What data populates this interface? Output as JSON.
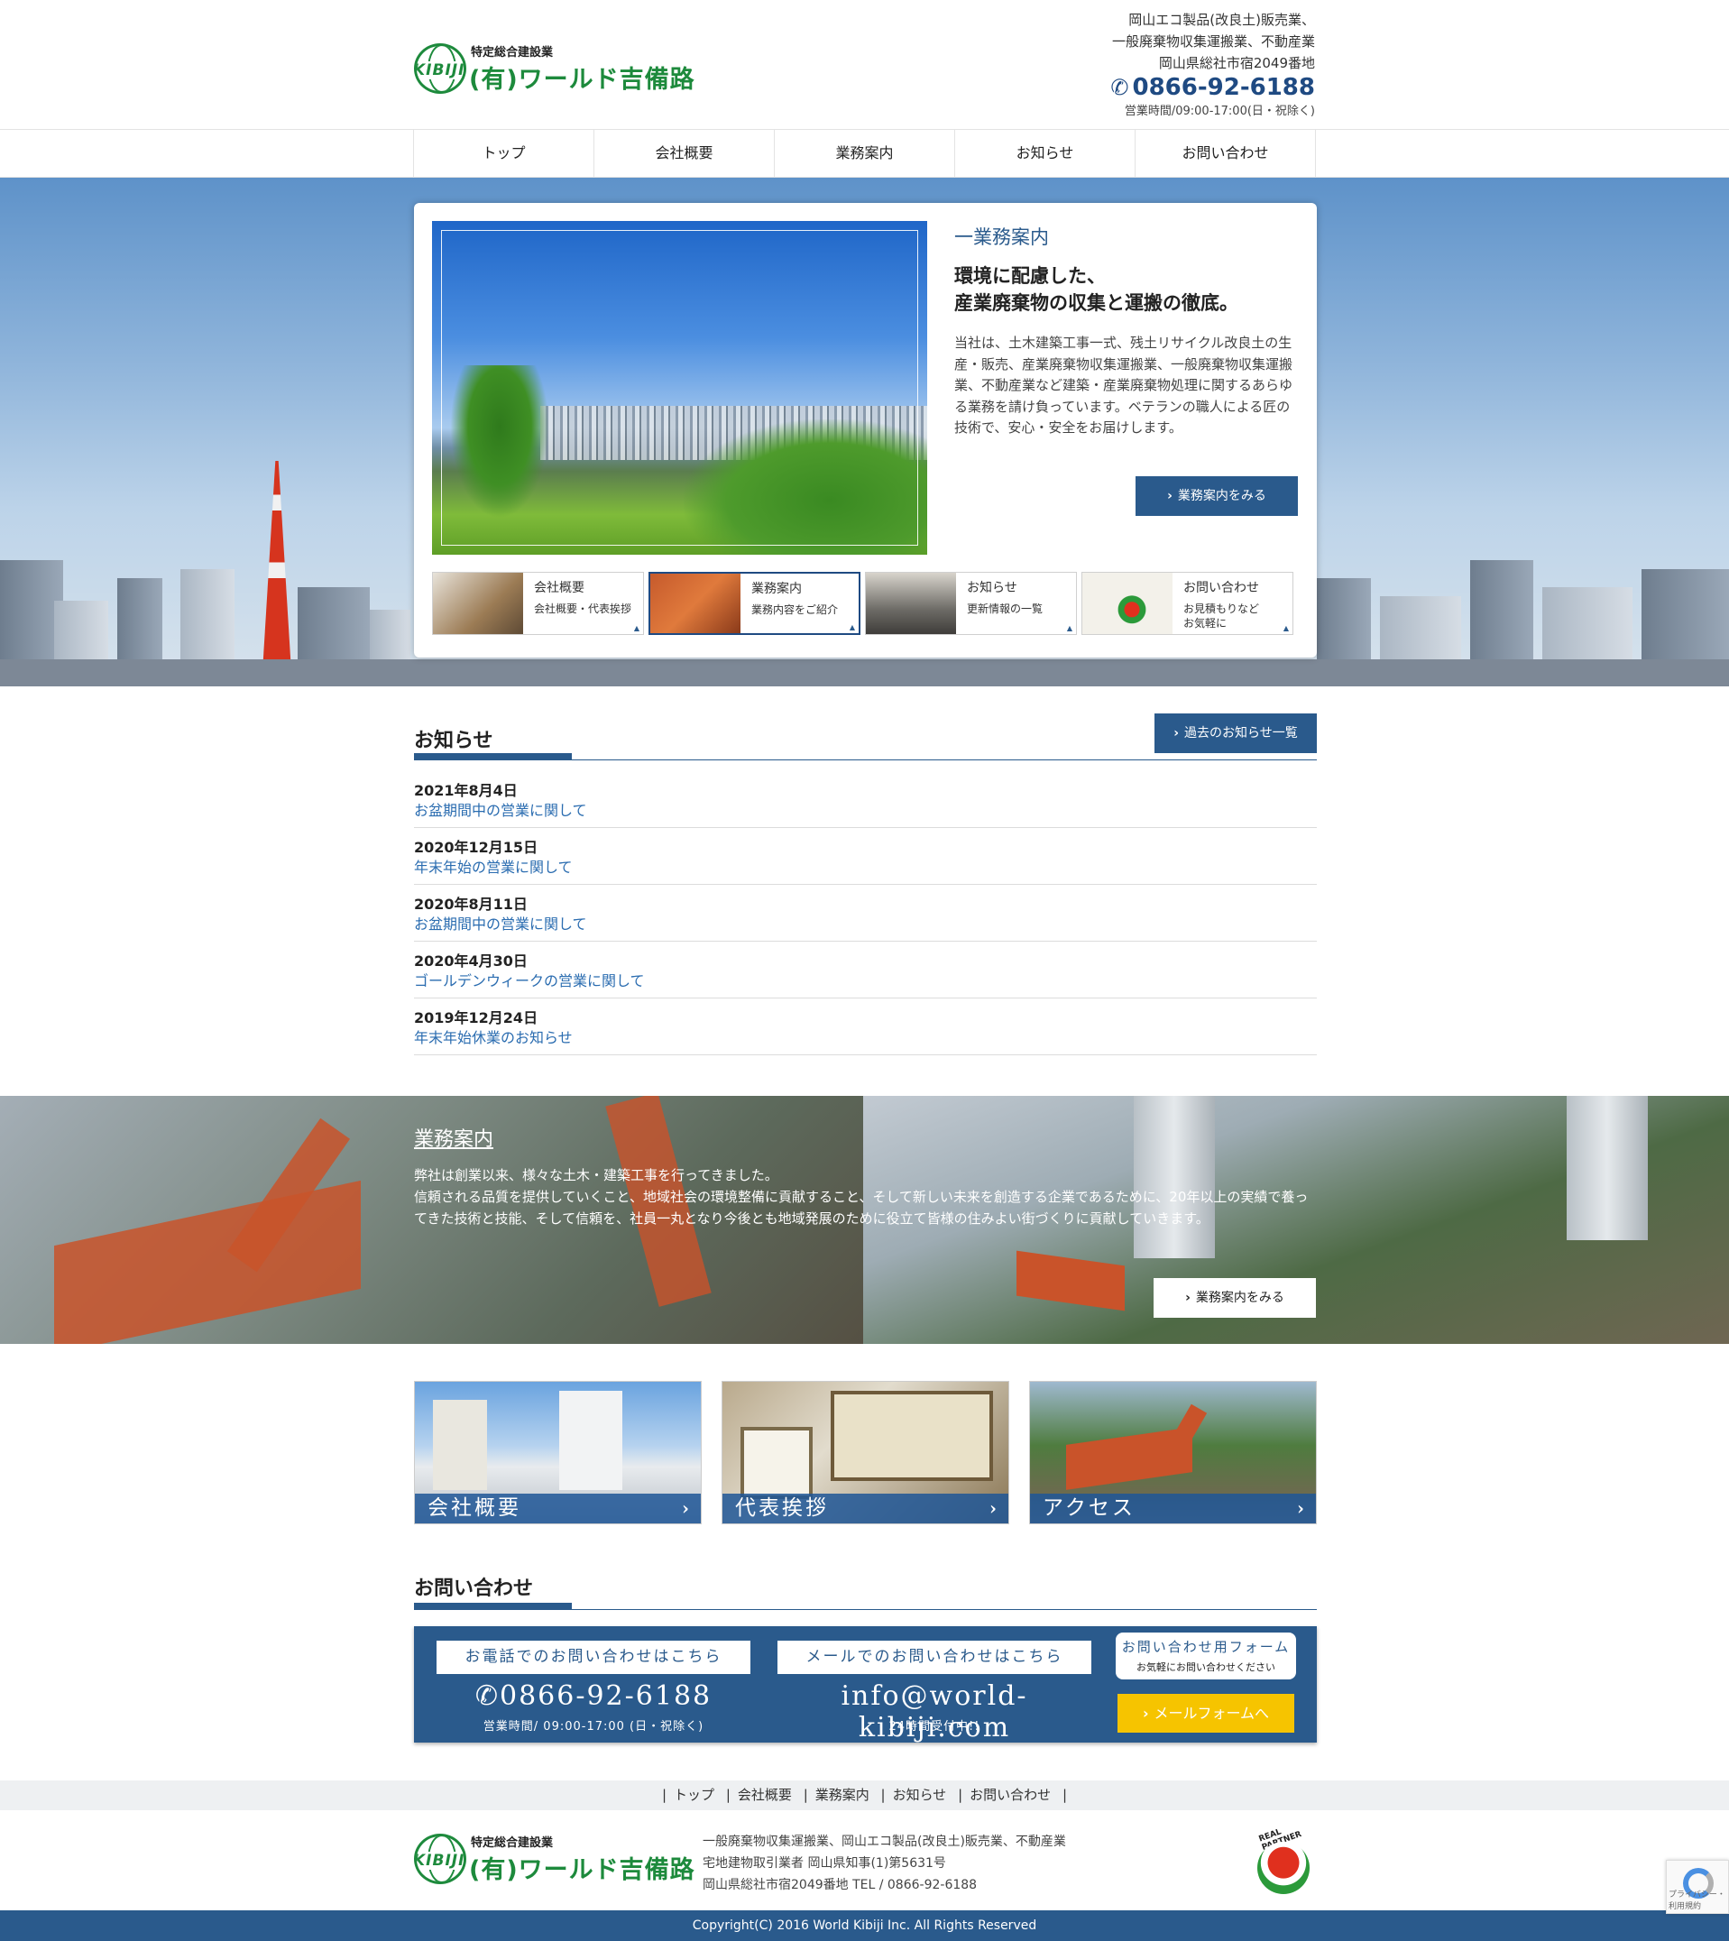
{
  "header": {
    "logo_sub": "特定総合建設業",
    "logo_main": "(有)ワールド吉備路",
    "logo_globe_text": "KIBIJI",
    "info_line1": "岡山エコ製品(改良土)販売業、",
    "info_line2": "一般廃棄物収集運搬業、不動産業",
    "info_line3": "岡山県総社市宿2049番地",
    "tel": "0866-92-6188",
    "hours": "営業時間/09:00-17:00(日・祝除く)"
  },
  "nav": [
    "トップ",
    "会社概要",
    "業務案内",
    "お知らせ",
    "お問い合わせ"
  ],
  "hero": {
    "section_label": "一業務案内",
    "lead_line1": "環境に配慮した、",
    "lead_line2": "産業廃棄物の収集と運搬の徹底。",
    "text": "当社は、土木建築工事一式、残土リサイクル改良土の生産・販売、産業廃棄物収集運搬業、一般廃棄物収集運搬業、不動産業など建築・産業廃棄物処理に関するあらゆる業務を請け負っています。ベテランの職人による匠の技術で、安心・安全をお届けします。",
    "button": "業務案内をみる",
    "thumbs": [
      {
        "title": "会社概要",
        "sub": "会社概要・代表挨拶"
      },
      {
        "title": "業務案内",
        "sub": "業務内容をご紹介"
      },
      {
        "title": "お知らせ",
        "sub": "更新情報の一覧"
      },
      {
        "title": "お問い合わせ",
        "sub": "お見積もりなど\nお気軽に"
      }
    ]
  },
  "news": {
    "title": "お知らせ",
    "archive_button": "過去のお知らせ一覧",
    "items": [
      {
        "date": "2021年8月4日",
        "title": "お盆期間中の営業に関して"
      },
      {
        "date": "2020年12月15日",
        "title": "年末年始の営業に関して"
      },
      {
        "date": "2020年8月11日",
        "title": "お盆期間中の営業に関して"
      },
      {
        "date": "2020年4月30日",
        "title": "ゴールデンウィークの営業に関して"
      },
      {
        "date": "2019年12月24日",
        "title": "年末年始休業のお知らせ"
      }
    ]
  },
  "service": {
    "title": "業務案内",
    "text_line1": "弊社は創業以来、様々な土木・建築工事を行ってきました。",
    "text_line2": "信頼される品質を提供していくこと、地域社会の環境整備に貢献すること、そして新しい未来を創造する企業であるために、20年以上の実績で養ってきた技術と技能、そして信頼を、社員一丸となり今後とも地域発展のために役立て皆様の住みよい街づくりに貢献していきます。",
    "button": "業務案内をみる"
  },
  "tiles": [
    "会社概要",
    "代表挨拶",
    "アクセス"
  ],
  "contact": {
    "title": "お問い合わせ",
    "phone_label": "お電話でのお問い合わせはこちら",
    "phone": "0866-92-6188",
    "phone_hours": "営業時間/ 09:00-17:00 (日・祝除く)",
    "mail_label": "メールでのお問い合わせはこちら",
    "mail": "info@world-kibiji.com",
    "mail_hours": "24時間受付中!!",
    "form_title": "お問い合わせ用フォーム",
    "form_sub": "お気軽にお問い合わせください",
    "form_button": "メールフォームへ"
  },
  "footer": {
    "nav": [
      "トップ",
      "会社概要",
      "業務案内",
      "お知らせ",
      "お問い合わせ"
    ],
    "info_line1": "一般廃棄物収集運搬業、岡山エコ製品(改良土)販売業、不動産業",
    "info_line2": "宅地建物取引業者 岡山県知事(1)第5631号",
    "info_line3": "岡山県総社市宿2049番地 TEL / 0866-92-6188",
    "badge": "REAL PARTNER",
    "copyright": "Copyright(C) 2016 World Kibiji Inc. All Rights Reserved",
    "recaptcha": "プライバシー・利用規約"
  },
  "colors": {
    "brand_blue": "#2a5a8c",
    "logo_green": "#1d8a3c",
    "button_yellow": "#f6c400"
  }
}
